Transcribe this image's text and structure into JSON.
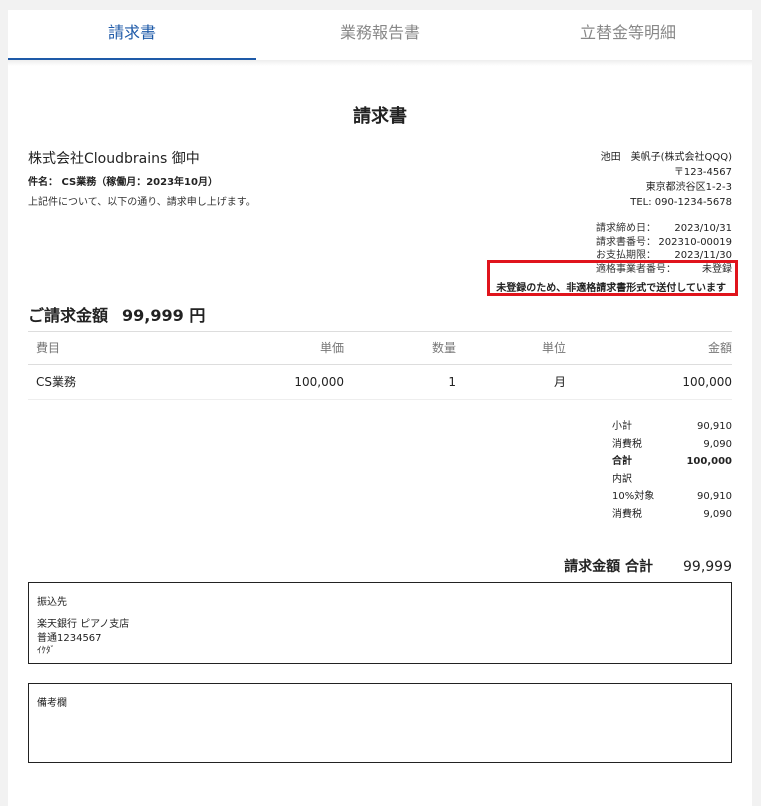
{
  "tabs": [
    "請求書",
    "業務報告書",
    "立替金等明細"
  ],
  "document": {
    "title": "請求書",
    "recipient": "株式会社Cloudbrains 御中",
    "subject": "件名： CS業務（稼働月：2023年10月）",
    "intro": "上記件について、以下の通り、請求申し上げます。"
  },
  "issuer": {
    "name": "池田　美帆子(株式会社QQQ)",
    "postal": "〒123-4567",
    "address": "東京都渋谷区1-2-3",
    "tel": "TEL: 090-1234-5678"
  },
  "meta": {
    "closing_label": "請求締め日：",
    "closing_value": "2023/10/31",
    "invoice_no_label": "請求書番号：",
    "invoice_no_value": "202310-00019",
    "due_label": "お支払期限：",
    "due_value": "2023/11/30",
    "reg_label": "適格事業者番号：",
    "reg_value": "未登録",
    "notice": "未登録のため、非適格請求書形式で送付しています"
  },
  "amount": {
    "label": "ご請求金額",
    "value": "99,999 円"
  },
  "table": {
    "headers": [
      "費目",
      "単価",
      "数量",
      "単位",
      "金額"
    ],
    "rows": [
      [
        "CS業務",
        "100,000",
        "1",
        "月",
        "100,000"
      ]
    ]
  },
  "totals": [
    {
      "label": "小計",
      "value": "90,910"
    },
    {
      "label": "消費税",
      "value": "9,090"
    },
    {
      "label": "合計",
      "value": "100,000"
    },
    {
      "label": "内訳",
      "value": ""
    },
    {
      "label": "10%対象",
      "value": "90,910"
    },
    {
      "label": "消費税",
      "value": "9,090"
    }
  ],
  "grand": {
    "label": "請求金額 合計",
    "value": "99,999"
  },
  "bank": {
    "label": "振込先",
    "line1": "楽天銀行 ピアノ支店",
    "line2": "普通1234567",
    "line3": "ｲｹﾀﾞ"
  },
  "remarks": {
    "label": "備考欄"
  },
  "colors": {
    "accent": "#1e5aa8",
    "highlight": "#e0141c"
  }
}
